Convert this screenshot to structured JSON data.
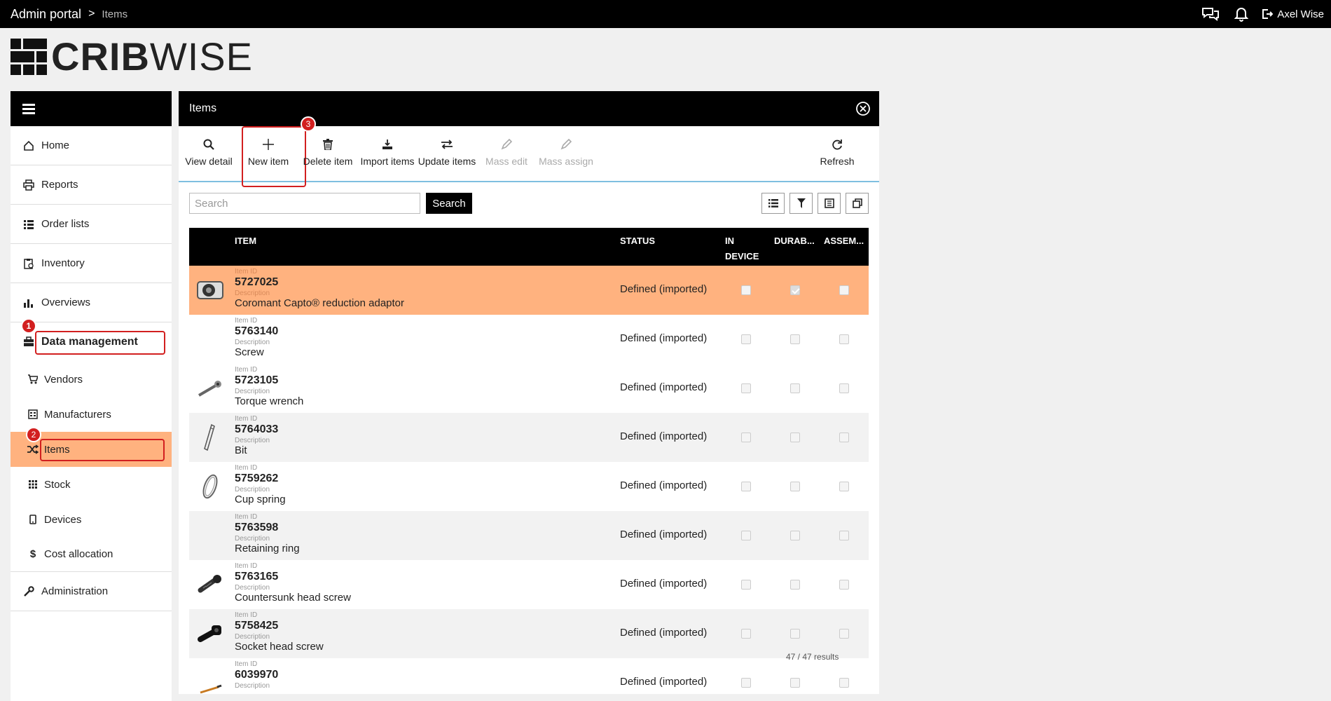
{
  "topbar": {
    "breadcrumb_root": "Admin portal",
    "breadcrumb_sep": ">",
    "breadcrumb_current": "Items",
    "user_name": "Axel Wise"
  },
  "logo": {
    "bold": "CRIB",
    "light": "WISE"
  },
  "sidebar": {
    "items": [
      {
        "label": "Home",
        "icon": "home-icon"
      },
      {
        "label": "Reports",
        "icon": "printer-icon"
      },
      {
        "label": "Order lists",
        "icon": "list-icon"
      },
      {
        "label": "Inventory",
        "icon": "clipboard-icon"
      },
      {
        "label": "Overviews",
        "icon": "bar-chart-icon"
      },
      {
        "label": "Data management",
        "icon": "briefcase-icon"
      }
    ],
    "sub_items": [
      {
        "label": "Vendors",
        "icon": "cart-icon"
      },
      {
        "label": "Manufacturers",
        "icon": "factory-icon"
      },
      {
        "label": "Items",
        "icon": "shuffle-icon"
      },
      {
        "label": "Stock",
        "icon": "grid-icon"
      },
      {
        "label": "Devices",
        "icon": "phone-icon"
      },
      {
        "label": "Cost allocation",
        "icon": "dollar-icon"
      }
    ],
    "admin": {
      "label": "Administration",
      "icon": "wrench-icon"
    }
  },
  "badges": {
    "b1": "1",
    "b2": "2",
    "b3": "3"
  },
  "panel": {
    "title": "Items",
    "toolbar": {
      "view_detail": "View detail",
      "new_item": "New item",
      "delete_item": "Delete item",
      "import_items": "Import items",
      "update_items": "Update items",
      "mass_edit": "Mass edit",
      "mass_assign": "Mass assign",
      "refresh": "Refresh"
    },
    "search": {
      "placeholder": "Search",
      "button": "Search"
    },
    "columns": {
      "item": "ITEM",
      "status": "STATUS",
      "in_device_1": "IN",
      "in_device_2": "DEVICE",
      "durable": "DURAB...",
      "assembly": "ASSEM..."
    },
    "labels": {
      "item_id": "Item ID",
      "description": "Description"
    },
    "rows": [
      {
        "id": "5727025",
        "desc": "Coromant Capto® reduction adaptor",
        "status": "Defined (imported)",
        "durable": true
      },
      {
        "id": "5763140",
        "desc": "Screw",
        "status": "Defined (imported)",
        "durable": false
      },
      {
        "id": "5723105",
        "desc": "Torque wrench",
        "status": "Defined (imported)",
        "durable": false
      },
      {
        "id": "5764033",
        "desc": "Bit",
        "status": "Defined (imported)",
        "durable": false
      },
      {
        "id": "5759262",
        "desc": "Cup spring",
        "status": "Defined (imported)",
        "durable": false
      },
      {
        "id": "5763598",
        "desc": "Retaining ring",
        "status": "Defined (imported)",
        "durable": false
      },
      {
        "id": "5763165",
        "desc": "Countersunk head screw",
        "status": "Defined (imported)",
        "durable": false
      },
      {
        "id": "5758425",
        "desc": "Socket head screw",
        "status": "Defined (imported)",
        "durable": false
      },
      {
        "id": "6039970",
        "desc": "",
        "status": "Defined (imported)",
        "durable": false
      }
    ],
    "results": "47 / 47 results"
  },
  "colors": {
    "accent": "#ffb27f",
    "highlight": "#d21f1f",
    "divider": "#7fbfe0"
  }
}
